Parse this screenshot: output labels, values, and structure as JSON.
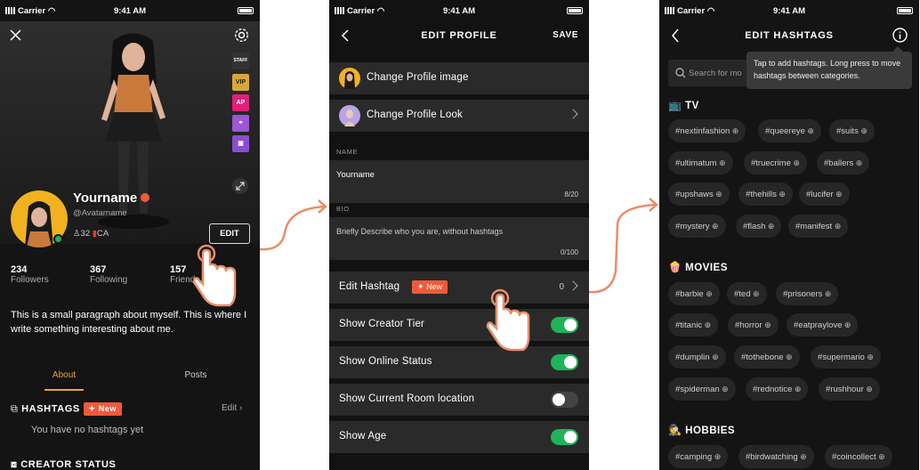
{
  "status": {
    "carrier": "Carrier",
    "time": "9:41 AM"
  },
  "screen1": {
    "badges": [
      "STAFF",
      "VIP",
      "AP"
    ],
    "name": "Yourname",
    "handle": "@Avatarname",
    "friends_count": "32",
    "country": "CA",
    "edit_label": "EDIT",
    "stats": [
      {
        "value": "234",
        "label": "Followers"
      },
      {
        "value": "367",
        "label": "Following"
      },
      {
        "value": "157",
        "label": "Friends"
      }
    ],
    "bio": "This is a small paragraph about myself. This is where I write something interesting about me.",
    "tabs": [
      "About",
      "Posts"
    ],
    "hashtags_title": "HASHTAGS",
    "new_label": "New",
    "hashtags_edit": "Edit",
    "hashtags_empty": "You have no hashtags yet",
    "creator_status": "CREATOR STATUS"
  },
  "screen2": {
    "title": "EDIT PROFILE",
    "save": "SAVE",
    "change_image": "Change Profile image",
    "change_look": "Change Profile Look",
    "name_label": "NAME",
    "name_value": "Yourname",
    "name_count": "8/20",
    "bio_label": "BIO",
    "bio_placeholder": "Briefly Describe who you are, without hashtags",
    "bio_count": "0/100",
    "edit_hashtag": "Edit Hashtag",
    "new_label": "New",
    "hashtag_count": "0",
    "toggles": [
      {
        "label": "Show Creator Tier",
        "on": true
      },
      {
        "label": "Show Online Status",
        "on": true
      },
      {
        "label": "Show Current Room location",
        "on": false
      },
      {
        "label": "Show Age",
        "on": true
      }
    ]
  },
  "screen3": {
    "title": "EDIT HASHTAGS",
    "search_placeholder": "Search for mo",
    "tooltip": "Tap to add hashtags. Long press to move hashtags between categories.",
    "categories": [
      {
        "name": "TV",
        "icon": "tv-icon",
        "tags": [
          "#nextinfashion",
          "#queereye",
          "#suits",
          "#ultimatum",
          "#truecrime",
          "#ballers",
          "#upshaws",
          "#thehills",
          "#lucifer",
          "#mystery",
          "#flash",
          "#manifest"
        ]
      },
      {
        "name": "MOVIES",
        "icon": "popcorn-icon",
        "tags": [
          "#barbie",
          "#ted",
          "#prisoners",
          "#titanic",
          "#horror",
          "#eatpraylove",
          "#dumplin",
          "#tothebone",
          "#supermario",
          "#spiderman",
          "#rednotice",
          "#rushhour"
        ]
      },
      {
        "name": "HOBBIES",
        "icon": "hobbies-icon",
        "tags": [
          "#camping",
          "#birdwatching",
          "#coincollect"
        ]
      }
    ]
  },
  "colors": {
    "accent": "#f05a3a",
    "toggle_on": "#1fb35b",
    "tab_active": "#e8a33d",
    "arrow": "#e98e6b"
  }
}
